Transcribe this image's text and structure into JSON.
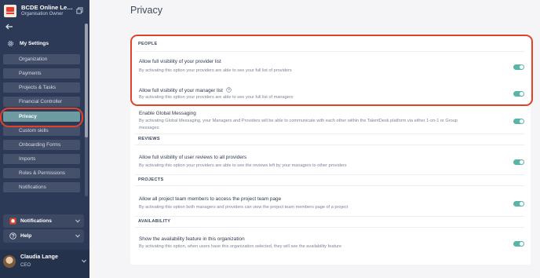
{
  "org": {
    "name": "BCDE Online Lear...",
    "role": "Organisation Owner"
  },
  "sidebar": {
    "section_title": "My Settings",
    "items": [
      {
        "label": "Organization"
      },
      {
        "label": "Payments"
      },
      {
        "label": "Projects & Tasks"
      },
      {
        "label": "Financial Controller"
      },
      {
        "label": "Privacy"
      },
      {
        "label": "Custom skills"
      },
      {
        "label": "Onboarding Forms"
      },
      {
        "label": "Imports"
      },
      {
        "label": "Roles & Permissions"
      },
      {
        "label": "Notifications"
      }
    ],
    "active_index": 4,
    "bottom": [
      {
        "label": "Notifications",
        "icon": "bell-icon"
      },
      {
        "label": "Help",
        "icon": "question-icon"
      }
    ]
  },
  "user": {
    "name": "Claudia Lange",
    "role": "CEO"
  },
  "page": {
    "title": "Privacy"
  },
  "sections": {
    "people": "PEOPLE",
    "reviews": "REVIEWS",
    "projects": "PROJECTS",
    "availability": "AVAILABILITY"
  },
  "settings": [
    {
      "title": "Allow full visibility of your provider list",
      "desc": "By activating this option your providers are able to see your full list of providers",
      "enabled": true
    },
    {
      "title": "Allow full visibility of your manager list",
      "desc": "By activating this option your providers are able to see your full list of managers",
      "enabled": true
    },
    {
      "title": "Enable Global Messaging",
      "desc": "By activating Global Messaging, your Managers and Providers will be able to communicate with each other within the TalentDesk platform via either 1-on-1 or Group",
      "desc2": "messages",
      "enabled": true
    },
    {
      "title": "Allow full visibility of user reviews to all providers",
      "desc": "By activating this option your providers are able to see the reviews left by your managers to other providers",
      "enabled": true
    },
    {
      "title": "Allow all project team members to access the project team page",
      "desc": "By activating this option both managers and providers can view the project team members page of a project",
      "enabled": true
    },
    {
      "title": "Show the availability feature in this organization",
      "desc": "By activating this option, when users have this organization selected, they will see the availability feature",
      "enabled": true
    }
  ],
  "colors": {
    "sidebar": "#2c3a57",
    "accent_toggle": "#58b5a7",
    "highlight": "#e14329",
    "active_nav": "#6e9aa2"
  }
}
